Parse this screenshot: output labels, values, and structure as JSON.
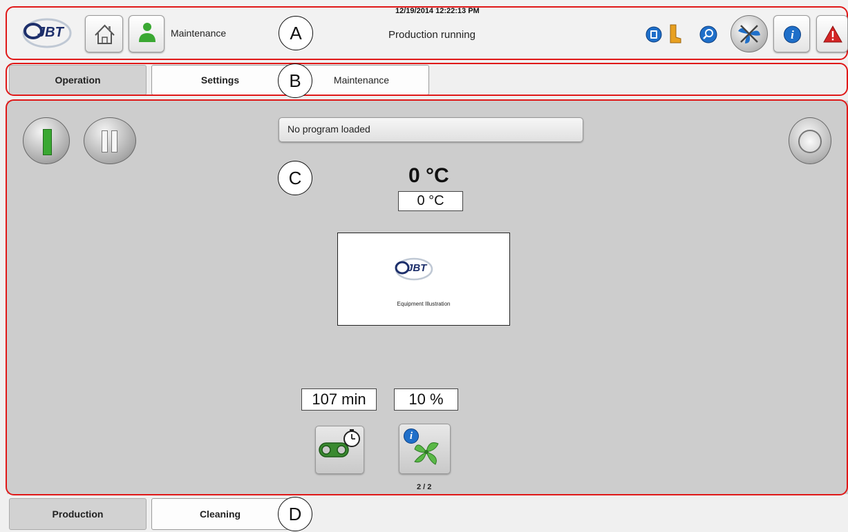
{
  "header": {
    "logo_text": "JBT",
    "user_label": "Maintenance",
    "datetime": "12/19/2014 12:22:13 PM",
    "status": "Production running",
    "callout": "A"
  },
  "tabs": {
    "items": [
      {
        "label": "Operation"
      },
      {
        "label": "Settings"
      },
      {
        "label": "Maintenance"
      }
    ],
    "callout": "B"
  },
  "main": {
    "program_field": "No program loaded",
    "temperature_large": "0 °C",
    "temperature_small": "0 °C",
    "equipment": {
      "logo_text": "JBT",
      "caption": "Equipment Illustration"
    },
    "time_value": "107 min",
    "fan_value": "10 %",
    "fan_page": "2 / 2",
    "callout": "C"
  },
  "bottom_tabs": {
    "items": [
      {
        "label": "Production"
      },
      {
        "label": "Cleaning"
      }
    ],
    "callout": "D"
  },
  "colors": {
    "callout_border": "#e01818",
    "start_green": "#3aa832",
    "fan_green": "#5ab847",
    "info_blue": "#1f6fc9",
    "alarm_red": "#d42424"
  }
}
